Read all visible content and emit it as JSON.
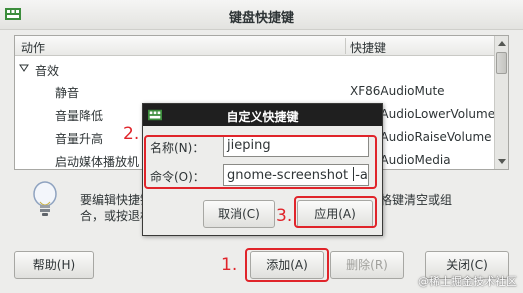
{
  "window": {
    "title": "键盘快捷键"
  },
  "list": {
    "headers": {
      "action": "动作",
      "shortcut": "快捷键"
    },
    "group": "音效",
    "rows": [
      {
        "action": "静音",
        "shortcut": "XF86AudioMute"
      },
      {
        "action": "音量降低",
        "shortcut": "XF86AudioLowerVolume"
      },
      {
        "action": "音量升高",
        "shortcut": "XF86AudioRaiseVolume"
      },
      {
        "action": "启动媒体播放机",
        "shortcut": "XF86AudioMedia"
      }
    ]
  },
  "help": {
    "line1": "要编辑快捷键，请点击相应行并输入新的快捷键，或按退格键清空或组",
    "line2": "合，或按退格键"
  },
  "buttons": {
    "help": "帮助(H)",
    "add": "添加(A)",
    "remove": "删除(R)",
    "close": "关闭(C)"
  },
  "dialog": {
    "title": "自定义快捷键",
    "name_label": "名称(N)：",
    "name_value": "jieping",
    "command_label": "命令(O)：",
    "command_value_before": "gnome-screenshot ",
    "command_value_after": "-a",
    "cancel": "取消(C)",
    "apply": "应用(A)"
  },
  "annotations": {
    "step1": "1.",
    "step2": "2.",
    "step3": "3."
  },
  "watermark": "@稀土掘金技术社区",
  "colors": {
    "annotation": "#e0242a",
    "dialog_titlebar": "#1f1f1f"
  }
}
